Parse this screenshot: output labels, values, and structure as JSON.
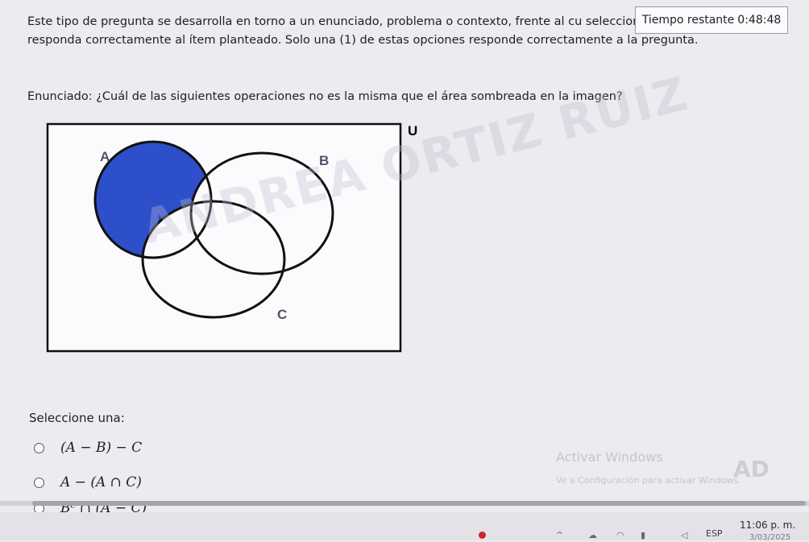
{
  "intro_text": "Este tipo de pregunta se desarrolla en torno a un enunciado, problema o contexto, frente al cu seleccionar aquella opción que responda correctamente al ítem planteado. Solo una (1) de estas opciones responde correctamente a la pregunta.",
  "timer": {
    "label": "Tiempo restante",
    "value": "0:48:48"
  },
  "question": "Enunciado: ¿Cuál de las siguientes operaciones no es la misma que el área sombreada en la imagen?",
  "venn": {
    "universe_label": "U",
    "set_labels": {
      "a": "A",
      "b": "B",
      "c": "C"
    },
    "shade_color": "#2d4fc9",
    "stroke_color": "#111111",
    "label_color": "#55506a"
  },
  "watermark": "ANDREA ORTIZ RUIZ",
  "select_label": "Seleccione una:",
  "options": [
    {
      "text": "(A − B) − C"
    },
    {
      "text": "A − (A ∩ C)"
    },
    {
      "text": "Bᶜ ∩ (A − C)"
    }
  ],
  "windows_activation": {
    "title": "Activar Windows",
    "subtitle": "Ve a Configuración para activar Windows."
  },
  "ad_logo": "AD",
  "taskbar": {
    "language": "ESP",
    "time": "11:06 p. m.",
    "date": "3/03/2025"
  },
  "icons": [
    "chevron-up-icon",
    "cloud-icon",
    "wifi-icon",
    "battery-icon",
    "speaker-icon",
    "notification-icon"
  ]
}
